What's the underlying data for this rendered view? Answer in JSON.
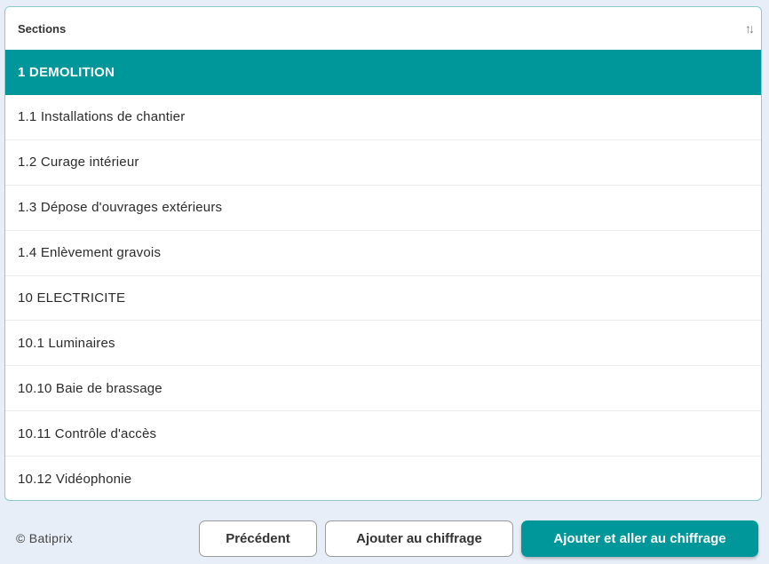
{
  "table": {
    "header": "Sections",
    "sort_icon": "↑↓",
    "rows": [
      {
        "label": "1 DEMOLITION",
        "selected": true
      },
      {
        "label": "1.1 Installations de chantier"
      },
      {
        "label": "1.2 Curage intérieur"
      },
      {
        "label": "1.3 Dépose d'ouvrages extérieurs"
      },
      {
        "label": "1.4 Enlèvement gravois"
      },
      {
        "label": "10 ELECTRICITE"
      },
      {
        "label": "10.1 Luminaires"
      },
      {
        "label": "10.10 Baie de brassage"
      },
      {
        "label": "10.11 Contrôle d'accès"
      },
      {
        "label": "10.12 Vidéophonie"
      }
    ]
  },
  "footer": {
    "copyright": "© Batiprix",
    "buttons": {
      "previous": "Précédent",
      "add": "Ajouter au chiffrage",
      "add_and_go": "Ajouter et aller au chiffrage"
    }
  },
  "colors": {
    "accent": "#00979a",
    "footer_bg": "#e8eef7"
  }
}
